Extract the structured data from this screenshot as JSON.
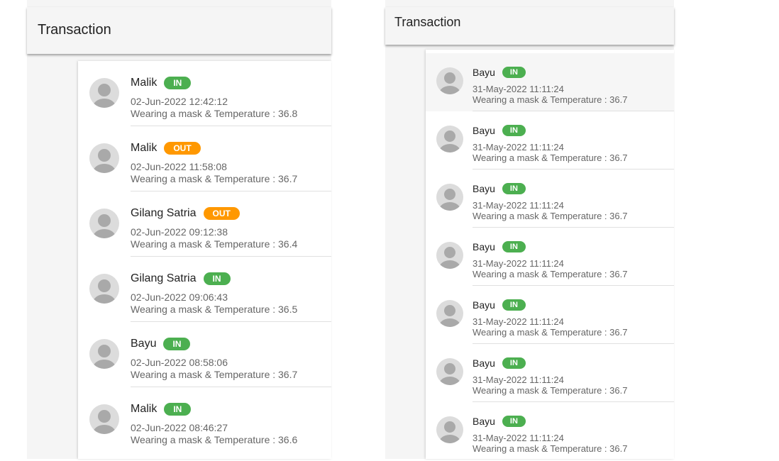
{
  "left_panel": {
    "title": "Transaction",
    "items": [
      {
        "name": "Malik",
        "status": "IN",
        "status_type": "in",
        "datetime": "02-Jun-2022 12:42:12",
        "description": "Wearing a mask & Temperature : 36.8"
      },
      {
        "name": "Malik",
        "status": "OUT",
        "status_type": "out",
        "datetime": "02-Jun-2022 11:58:08",
        "description": "Wearing a mask & Temperature : 36.7"
      },
      {
        "name": "Gilang Satria",
        "status": "OUT",
        "status_type": "out",
        "datetime": "02-Jun-2022 09:12:38",
        "description": "Wearing a mask & Temperature : 36.4"
      },
      {
        "name": "Gilang Satria",
        "status": "IN",
        "status_type": "in",
        "datetime": "02-Jun-2022 09:06:43",
        "description": "Wearing a mask & Temperature : 36.5"
      },
      {
        "name": "Bayu",
        "status": "IN",
        "status_type": "in",
        "datetime": "02-Jun-2022 08:58:06",
        "description": "Wearing a mask & Temperature : 36.7"
      },
      {
        "name": "Malik",
        "status": "IN",
        "status_type": "in",
        "datetime": "02-Jun-2022 08:46:27",
        "description": "Wearing a mask & Temperature : 36.6"
      }
    ]
  },
  "right_panel": {
    "title": "Transaction",
    "items": [
      {
        "name": "Bayu",
        "status": "IN",
        "status_type": "in",
        "datetime": "31-May-2022 11:11:24",
        "description": "Wearing a mask & Temperature : 36.7"
      },
      {
        "name": "Bayu",
        "status": "IN",
        "status_type": "in",
        "datetime": "31-May-2022 11:11:24",
        "description": "Wearing a mask & Temperature : 36.7"
      },
      {
        "name": "Bayu",
        "status": "IN",
        "status_type": "in",
        "datetime": "31-May-2022 11:11:24",
        "description": "Wearing a mask & Temperature : 36.7"
      },
      {
        "name": "Bayu",
        "status": "IN",
        "status_type": "in",
        "datetime": "31-May-2022 11:11:24",
        "description": "Wearing a mask & Temperature : 36.7"
      },
      {
        "name": "Bayu",
        "status": "IN",
        "status_type": "in",
        "datetime": "31-May-2022 11:11:24",
        "description": "Wearing a mask & Temperature : 36.7"
      },
      {
        "name": "Bayu",
        "status": "IN",
        "status_type": "in",
        "datetime": "31-May-2022 11:11:24",
        "description": "Wearing a mask & Temperature : 36.7"
      },
      {
        "name": "Bayu",
        "status": "IN",
        "status_type": "in",
        "datetime": "31-May-2022 11:11:24",
        "description": "Wearing a mask & Temperature : 36.7"
      }
    ]
  },
  "colors": {
    "in_badge": "#4caf50",
    "out_badge": "#ff9800"
  },
  "icons": {
    "avatar": "user-avatar-icon"
  }
}
